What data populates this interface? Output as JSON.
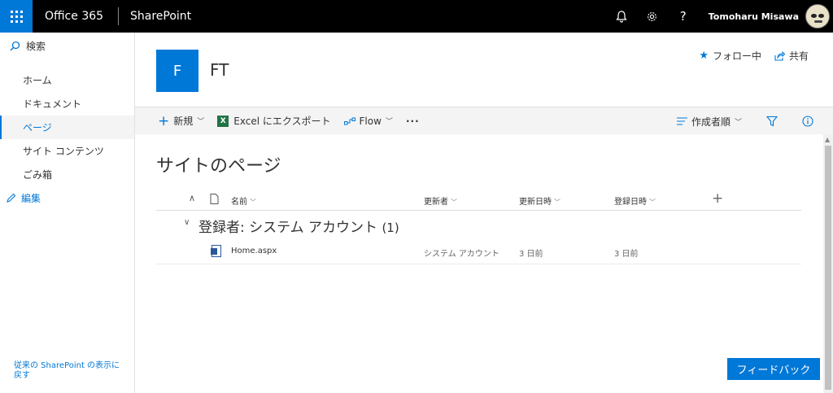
{
  "suitebar": {
    "brand": "Office 365",
    "app": "SharePoint",
    "user_name": "Tomoharu Misawa",
    "icons": [
      "bell-icon",
      "gear-icon",
      "help-icon"
    ],
    "help_glyph": "?"
  },
  "leftnav": {
    "search_label": "検索",
    "items": [
      {
        "label": "ホーム"
      },
      {
        "label": "ドキュメント"
      },
      {
        "label": "ページ"
      },
      {
        "label": "サイト コンテンツ"
      },
      {
        "label": "ごみ箱"
      }
    ],
    "edit_label": "編集",
    "classic_link": "従来の SharePoint の表示に戻す"
  },
  "site": {
    "logo_letter": "F",
    "title": "FT",
    "follow_label": "フォロー中",
    "share_label": "共有"
  },
  "commandbar": {
    "new_label": "新規",
    "excel_label": "Excel にエクスポート",
    "excel_glyph": "X",
    "flow_label": "Flow",
    "more_label": "···",
    "sort_label": "作成者順"
  },
  "content": {
    "heading": "サイトのページ",
    "columns": {
      "name": "名前",
      "modified_by": "更新者",
      "modified": "更新日時",
      "created": "登録日時"
    },
    "group_label": "登録者: システム アカウント",
    "group_count": "(1)",
    "files": [
      {
        "name": "Home.aspx",
        "modified_by": "システム アカウント",
        "modified": "3 日前",
        "created": "3 日前"
      }
    ]
  },
  "feedback_label": "フィードバック",
  "colors": {
    "accent": "#0078d7",
    "suitebar": "#000000",
    "excel": "#217346"
  }
}
